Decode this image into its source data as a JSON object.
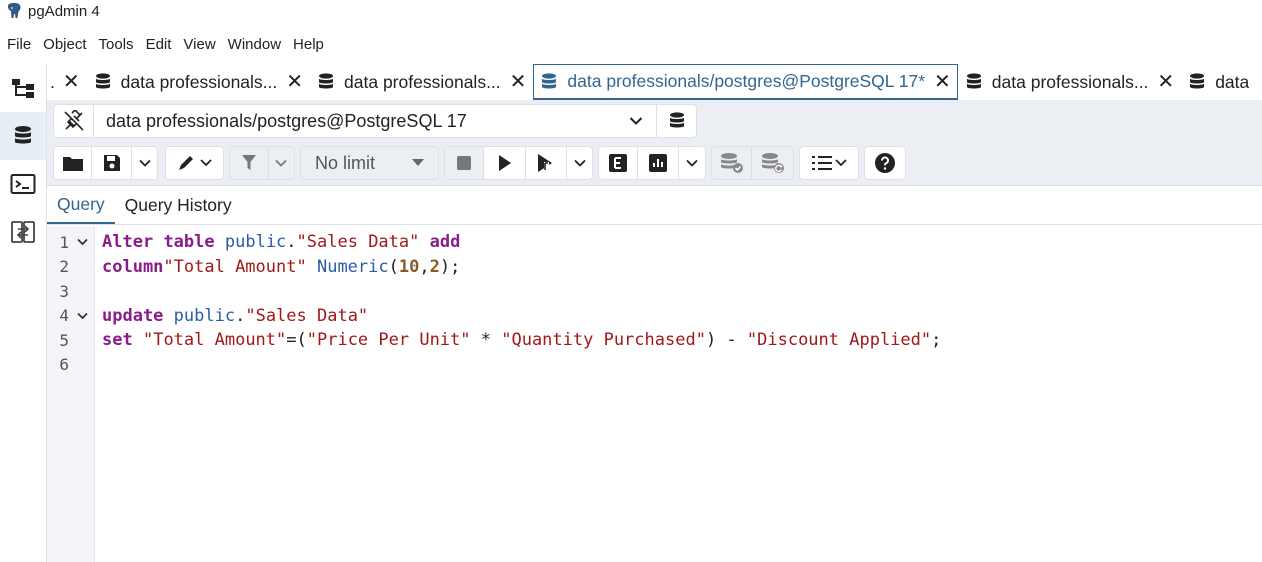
{
  "window": {
    "title": "pgAdmin 4"
  },
  "menu": [
    "File",
    "Object",
    "Tools",
    "Edit",
    "View",
    "Window",
    "Help"
  ],
  "tabs": [
    {
      "label": ".",
      "active": false
    },
    {
      "label": "data professionals...",
      "active": false
    },
    {
      "label": "data professionals...",
      "active": false
    },
    {
      "label": "data professionals/postgres@PostgreSQL 17*",
      "active": true
    },
    {
      "label": "data professionals...",
      "active": false
    },
    {
      "label": "data",
      "active": false
    }
  ],
  "connection": {
    "label": "data professionals/postgres@PostgreSQL 17"
  },
  "toolbar": {
    "limit_value": "No limit"
  },
  "subtabs": [
    {
      "label": "Query",
      "active": true
    },
    {
      "label": "Query History",
      "active": false
    }
  ],
  "editor": {
    "line_numbers": [
      "1",
      "2",
      "3",
      "4",
      "5",
      "6"
    ],
    "lines": [
      [
        {
          "t": "Alter",
          "c": "kw"
        },
        {
          "t": " ",
          "c": "pun"
        },
        {
          "t": "table",
          "c": "kw"
        },
        {
          "t": " ",
          "c": "pun"
        },
        {
          "t": "public",
          "c": "sch"
        },
        {
          "t": ".",
          "c": "pun"
        },
        {
          "t": "\"Sales Data\"",
          "c": "str"
        },
        {
          "t": " ",
          "c": "pun"
        },
        {
          "t": "add",
          "c": "kw"
        }
      ],
      [
        {
          "t": "column",
          "c": "kw"
        },
        {
          "t": "\"Total Amount\"",
          "c": "str"
        },
        {
          "t": " ",
          "c": "pun"
        },
        {
          "t": "Numeric",
          "c": "typ"
        },
        {
          "t": "(",
          "c": "pun"
        },
        {
          "t": "10",
          "c": "num"
        },
        {
          "t": ",",
          "c": "pun"
        },
        {
          "t": "2",
          "c": "num"
        },
        {
          "t": ");",
          "c": "pun"
        }
      ],
      [],
      [
        {
          "t": "update",
          "c": "kw"
        },
        {
          "t": " ",
          "c": "pun"
        },
        {
          "t": "public",
          "c": "sch"
        },
        {
          "t": ".",
          "c": "pun"
        },
        {
          "t": "\"Sales Data\"",
          "c": "str"
        }
      ],
      [
        {
          "t": "set",
          "c": "kw"
        },
        {
          "t": " ",
          "c": "pun"
        },
        {
          "t": "\"Total Amount\"",
          "c": "str"
        },
        {
          "t": "=(",
          "c": "pun"
        },
        {
          "t": "\"Price Per Unit\"",
          "c": "str"
        },
        {
          "t": " * ",
          "c": "pun"
        },
        {
          "t": "\"Quantity Purchased\"",
          "c": "str"
        },
        {
          "t": ") - ",
          "c": "pun"
        },
        {
          "t": "\"Discount Applied\"",
          "c": "str"
        },
        {
          "t": ";",
          "c": "pun"
        }
      ],
      []
    ],
    "folds": [
      "1",
      "4"
    ]
  }
}
